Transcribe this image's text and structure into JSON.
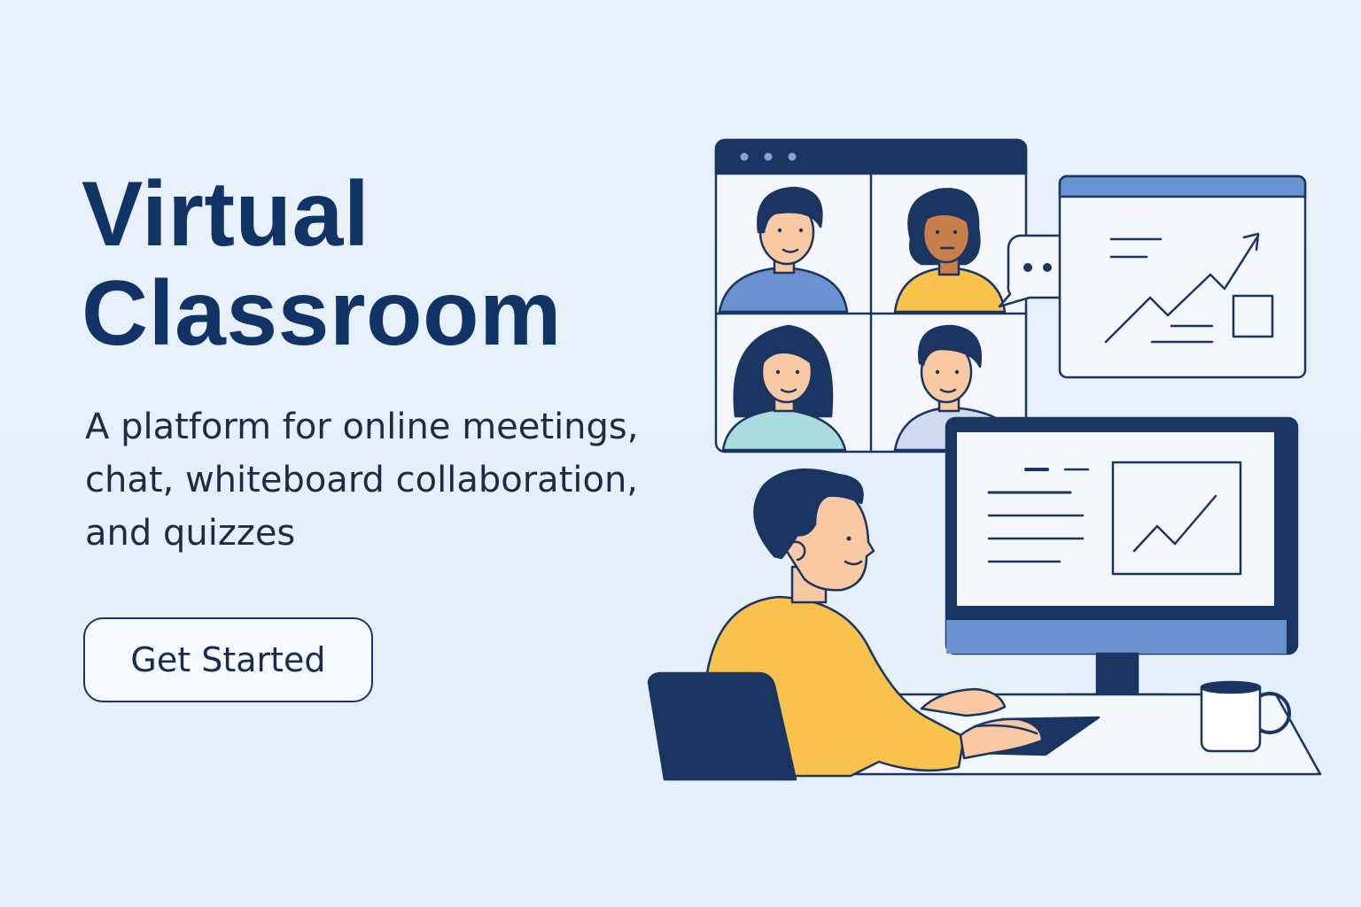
{
  "hero": {
    "title_line1": "Virtual",
    "title_line2": "Classroom",
    "subtitle": "A platform for online meetings, chat, whiteboard collaboration, and quizzes",
    "cta_label": "Get Started"
  },
  "colors": {
    "background": "#e6f1fc",
    "navy": "#1b3563",
    "accent_blue": "#6a92d0",
    "yellow": "#f8c24c",
    "skin": "#f8c9a3"
  },
  "illustration": {
    "video_tiles": 4,
    "chat_bubble_icon": "chat-bubble-icon",
    "chart_icon": "trend-chart-icon"
  }
}
